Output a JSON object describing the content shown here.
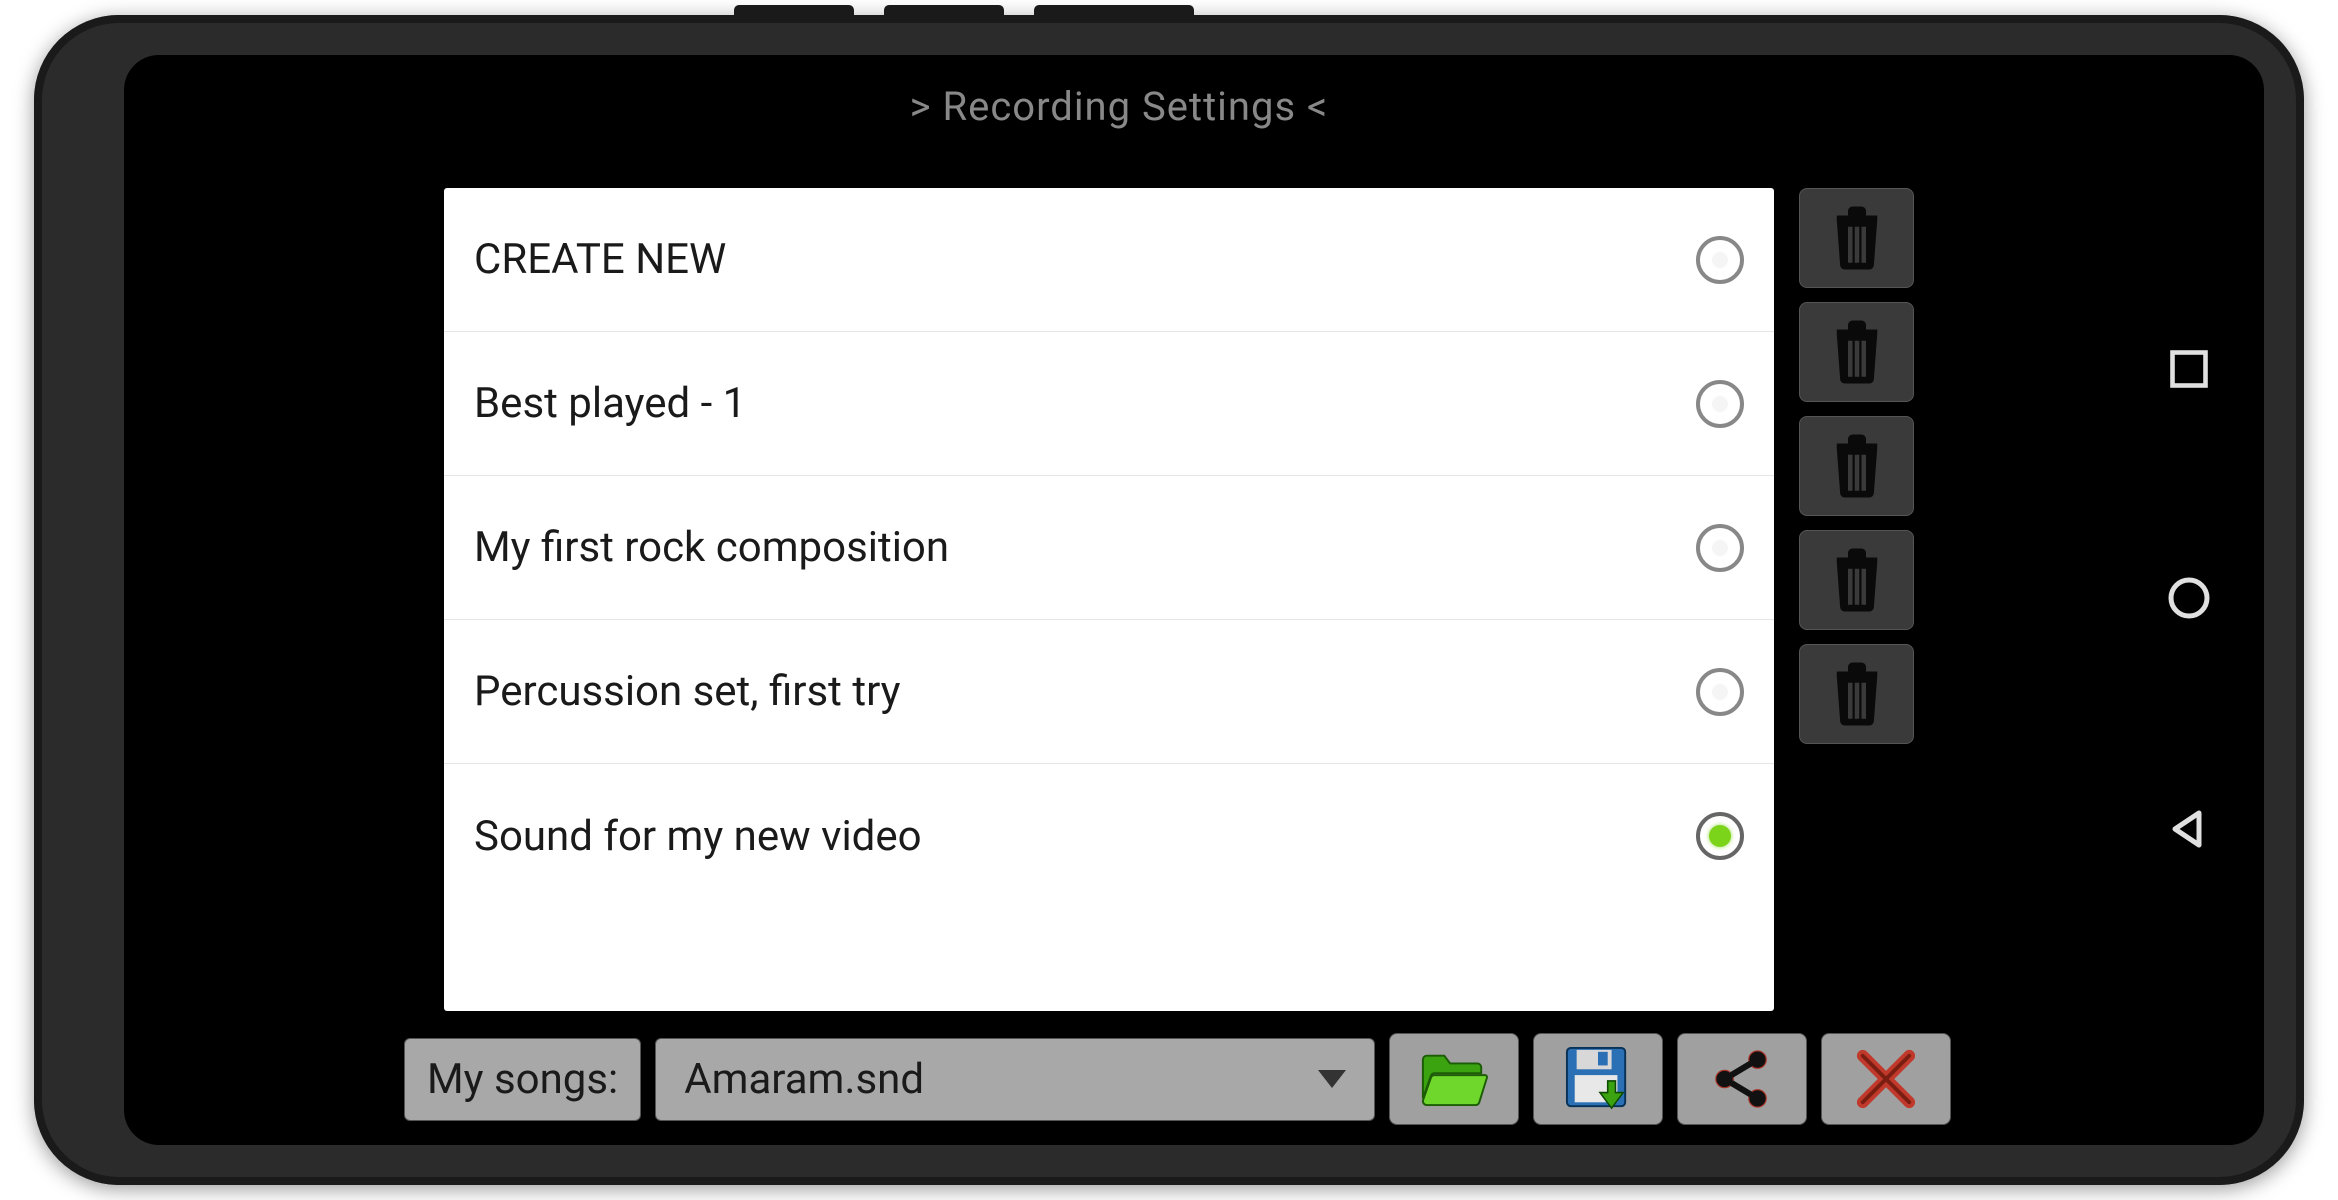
{
  "header": {
    "title": "> Recording Settings <"
  },
  "list": {
    "items": [
      {
        "label": "CREATE NEW",
        "selected": false
      },
      {
        "label": "Best played - 1",
        "selected": false
      },
      {
        "label": "My first rock composition",
        "selected": false
      },
      {
        "label": "Percussion set, first try",
        "selected": false
      },
      {
        "label": "Sound for my new video",
        "selected": true
      }
    ]
  },
  "bottom": {
    "label": "My songs:",
    "selected_song": "Amaram.snd"
  },
  "icons": {
    "delete": "trash-icon",
    "open": "folder-open-icon",
    "save": "floppy-save-icon",
    "share": "share-icon",
    "close": "close-x-icon",
    "nav_recent": "square-icon",
    "nav_home": "circle-icon",
    "nav_back": "triangle-back-icon"
  }
}
